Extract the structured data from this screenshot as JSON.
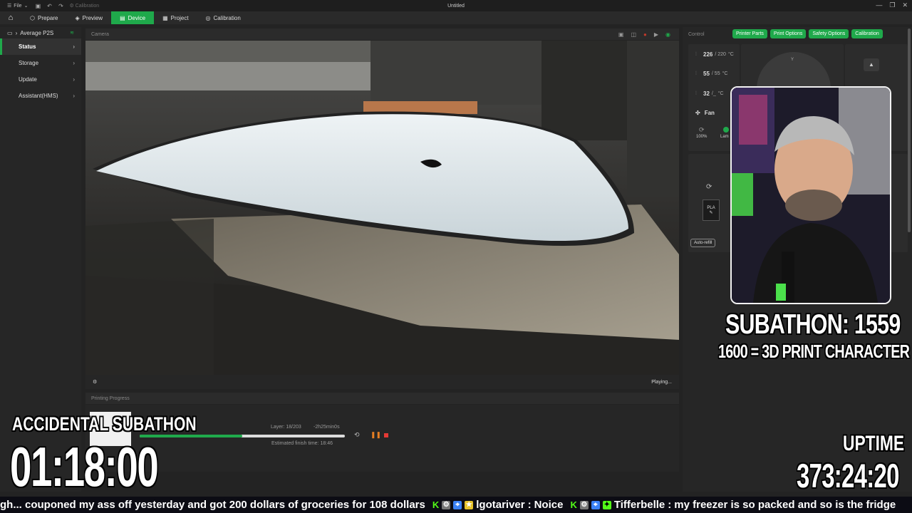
{
  "app": {
    "file_menu": "File",
    "calibration_shortcut": "Calibration",
    "window_title": "Untitled",
    "window_controls": [
      "—",
      "❐",
      "✕"
    ]
  },
  "nav": {
    "tabs": [
      {
        "label": "Prepare",
        "icon": "cube-icon"
      },
      {
        "label": "Preview",
        "icon": "layers-icon"
      },
      {
        "label": "Device",
        "icon": "printer-icon",
        "active": true
      },
      {
        "label": "Project",
        "icon": "document-icon"
      },
      {
        "label": "Calibration",
        "icon": "target-icon"
      }
    ]
  },
  "sidebar": {
    "device_name": "Average P2S",
    "items": [
      {
        "label": "Status",
        "active": true
      },
      {
        "label": "Storage"
      },
      {
        "label": "Update"
      },
      {
        "label": "Assistant(HMS)"
      }
    ]
  },
  "camera": {
    "title": "Camera",
    "status": "Playing..."
  },
  "progress": {
    "title": "Printing Progress",
    "layer": "Layer: 18/203",
    "remaining": "-2h25min0s",
    "finish": "Estimated finish time: 18:46",
    "percent": 0.5
  },
  "control": {
    "title": "Control",
    "buttons": [
      "Printer Parts",
      "Print Options",
      "Safety Options",
      "Calibration"
    ],
    "nozzle": {
      "current": "226",
      "target": "/ 220",
      "unit": "°C"
    },
    "bed": {
      "current": "55",
      "target": "/ 55",
      "unit": "°C"
    },
    "chamber": {
      "current": "32",
      "target": "/_",
      "unit": "°C"
    },
    "fan_label": "Fan",
    "fan_pct": "100%",
    "lamp_label": "Lam",
    "axis_label": "Y",
    "slot_label": "PLA",
    "auto_refill": "Auto-refill"
  },
  "overlay": {
    "subathon": "SUBATHON: 1559",
    "goal": "1600 = 3D PRINT CHARACTER",
    "accidental": "ACCIDENTAL SUBATHON",
    "timer": "01:18:00",
    "uptime_label": "UPTIME",
    "uptime_value": "373:24:20"
  },
  "ticker": {
    "msg1": "gh... couponed my ass off yesterday and got 200 dollars of groceries for 108 dollars",
    "user2": "lgotariver",
    "msg2": "Noice",
    "user3": "Tifferbelle",
    "msg3": "my freezer is so packed and so is the fridge"
  },
  "colors": {
    "accent": "#1fa94b",
    "kick": "#53fc18"
  }
}
